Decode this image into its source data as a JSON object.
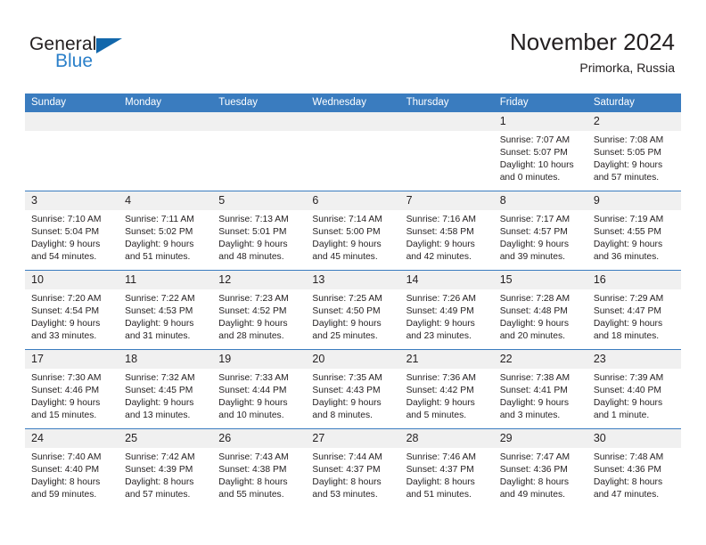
{
  "brand": {
    "word_one": "General",
    "word_two": "Blue",
    "accent_color": "#2a7fc9",
    "triangle_color": "#1267ab"
  },
  "header": {
    "title": "November 2024",
    "location": "Primorka, Russia"
  },
  "theme": {
    "header_row_color": "#3a7cbf",
    "day_band_color": "#f0f0f0",
    "text_color": "#231f20"
  },
  "columns": [
    "Sunday",
    "Monday",
    "Tuesday",
    "Wednesday",
    "Thursday",
    "Friday",
    "Saturday"
  ],
  "weeks": [
    [
      {
        "day": "",
        "lines": []
      },
      {
        "day": "",
        "lines": []
      },
      {
        "day": "",
        "lines": []
      },
      {
        "day": "",
        "lines": []
      },
      {
        "day": "",
        "lines": []
      },
      {
        "day": "1",
        "lines": [
          "Sunrise: 7:07 AM",
          "Sunset: 5:07 PM",
          "Daylight: 10 hours",
          "and 0 minutes."
        ]
      },
      {
        "day": "2",
        "lines": [
          "Sunrise: 7:08 AM",
          "Sunset: 5:05 PM",
          "Daylight: 9 hours",
          "and 57 minutes."
        ]
      }
    ],
    [
      {
        "day": "3",
        "lines": [
          "Sunrise: 7:10 AM",
          "Sunset: 5:04 PM",
          "Daylight: 9 hours",
          "and 54 minutes."
        ]
      },
      {
        "day": "4",
        "lines": [
          "Sunrise: 7:11 AM",
          "Sunset: 5:02 PM",
          "Daylight: 9 hours",
          "and 51 minutes."
        ]
      },
      {
        "day": "5",
        "lines": [
          "Sunrise: 7:13 AM",
          "Sunset: 5:01 PM",
          "Daylight: 9 hours",
          "and 48 minutes."
        ]
      },
      {
        "day": "6",
        "lines": [
          "Sunrise: 7:14 AM",
          "Sunset: 5:00 PM",
          "Daylight: 9 hours",
          "and 45 minutes."
        ]
      },
      {
        "day": "7",
        "lines": [
          "Sunrise: 7:16 AM",
          "Sunset: 4:58 PM",
          "Daylight: 9 hours",
          "and 42 minutes."
        ]
      },
      {
        "day": "8",
        "lines": [
          "Sunrise: 7:17 AM",
          "Sunset: 4:57 PM",
          "Daylight: 9 hours",
          "and 39 minutes."
        ]
      },
      {
        "day": "9",
        "lines": [
          "Sunrise: 7:19 AM",
          "Sunset: 4:55 PM",
          "Daylight: 9 hours",
          "and 36 minutes."
        ]
      }
    ],
    [
      {
        "day": "10",
        "lines": [
          "Sunrise: 7:20 AM",
          "Sunset: 4:54 PM",
          "Daylight: 9 hours",
          "and 33 minutes."
        ]
      },
      {
        "day": "11",
        "lines": [
          "Sunrise: 7:22 AM",
          "Sunset: 4:53 PM",
          "Daylight: 9 hours",
          "and 31 minutes."
        ]
      },
      {
        "day": "12",
        "lines": [
          "Sunrise: 7:23 AM",
          "Sunset: 4:52 PM",
          "Daylight: 9 hours",
          "and 28 minutes."
        ]
      },
      {
        "day": "13",
        "lines": [
          "Sunrise: 7:25 AM",
          "Sunset: 4:50 PM",
          "Daylight: 9 hours",
          "and 25 minutes."
        ]
      },
      {
        "day": "14",
        "lines": [
          "Sunrise: 7:26 AM",
          "Sunset: 4:49 PM",
          "Daylight: 9 hours",
          "and 23 minutes."
        ]
      },
      {
        "day": "15",
        "lines": [
          "Sunrise: 7:28 AM",
          "Sunset: 4:48 PM",
          "Daylight: 9 hours",
          "and 20 minutes."
        ]
      },
      {
        "day": "16",
        "lines": [
          "Sunrise: 7:29 AM",
          "Sunset: 4:47 PM",
          "Daylight: 9 hours",
          "and 18 minutes."
        ]
      }
    ],
    [
      {
        "day": "17",
        "lines": [
          "Sunrise: 7:30 AM",
          "Sunset: 4:46 PM",
          "Daylight: 9 hours",
          "and 15 minutes."
        ]
      },
      {
        "day": "18",
        "lines": [
          "Sunrise: 7:32 AM",
          "Sunset: 4:45 PM",
          "Daylight: 9 hours",
          "and 13 minutes."
        ]
      },
      {
        "day": "19",
        "lines": [
          "Sunrise: 7:33 AM",
          "Sunset: 4:44 PM",
          "Daylight: 9 hours",
          "and 10 minutes."
        ]
      },
      {
        "day": "20",
        "lines": [
          "Sunrise: 7:35 AM",
          "Sunset: 4:43 PM",
          "Daylight: 9 hours",
          "and 8 minutes."
        ]
      },
      {
        "day": "21",
        "lines": [
          "Sunrise: 7:36 AM",
          "Sunset: 4:42 PM",
          "Daylight: 9 hours",
          "and 5 minutes."
        ]
      },
      {
        "day": "22",
        "lines": [
          "Sunrise: 7:38 AM",
          "Sunset: 4:41 PM",
          "Daylight: 9 hours",
          "and 3 minutes."
        ]
      },
      {
        "day": "23",
        "lines": [
          "Sunrise: 7:39 AM",
          "Sunset: 4:40 PM",
          "Daylight: 9 hours",
          "and 1 minute."
        ]
      }
    ],
    [
      {
        "day": "24",
        "lines": [
          "Sunrise: 7:40 AM",
          "Sunset: 4:40 PM",
          "Daylight: 8 hours",
          "and 59 minutes."
        ]
      },
      {
        "day": "25",
        "lines": [
          "Sunrise: 7:42 AM",
          "Sunset: 4:39 PM",
          "Daylight: 8 hours",
          "and 57 minutes."
        ]
      },
      {
        "day": "26",
        "lines": [
          "Sunrise: 7:43 AM",
          "Sunset: 4:38 PM",
          "Daylight: 8 hours",
          "and 55 minutes."
        ]
      },
      {
        "day": "27",
        "lines": [
          "Sunrise: 7:44 AM",
          "Sunset: 4:37 PM",
          "Daylight: 8 hours",
          "and 53 minutes."
        ]
      },
      {
        "day": "28",
        "lines": [
          "Sunrise: 7:46 AM",
          "Sunset: 4:37 PM",
          "Daylight: 8 hours",
          "and 51 minutes."
        ]
      },
      {
        "day": "29",
        "lines": [
          "Sunrise: 7:47 AM",
          "Sunset: 4:36 PM",
          "Daylight: 8 hours",
          "and 49 minutes."
        ]
      },
      {
        "day": "30",
        "lines": [
          "Sunrise: 7:48 AM",
          "Sunset: 4:36 PM",
          "Daylight: 8 hours",
          "and 47 minutes."
        ]
      }
    ]
  ]
}
